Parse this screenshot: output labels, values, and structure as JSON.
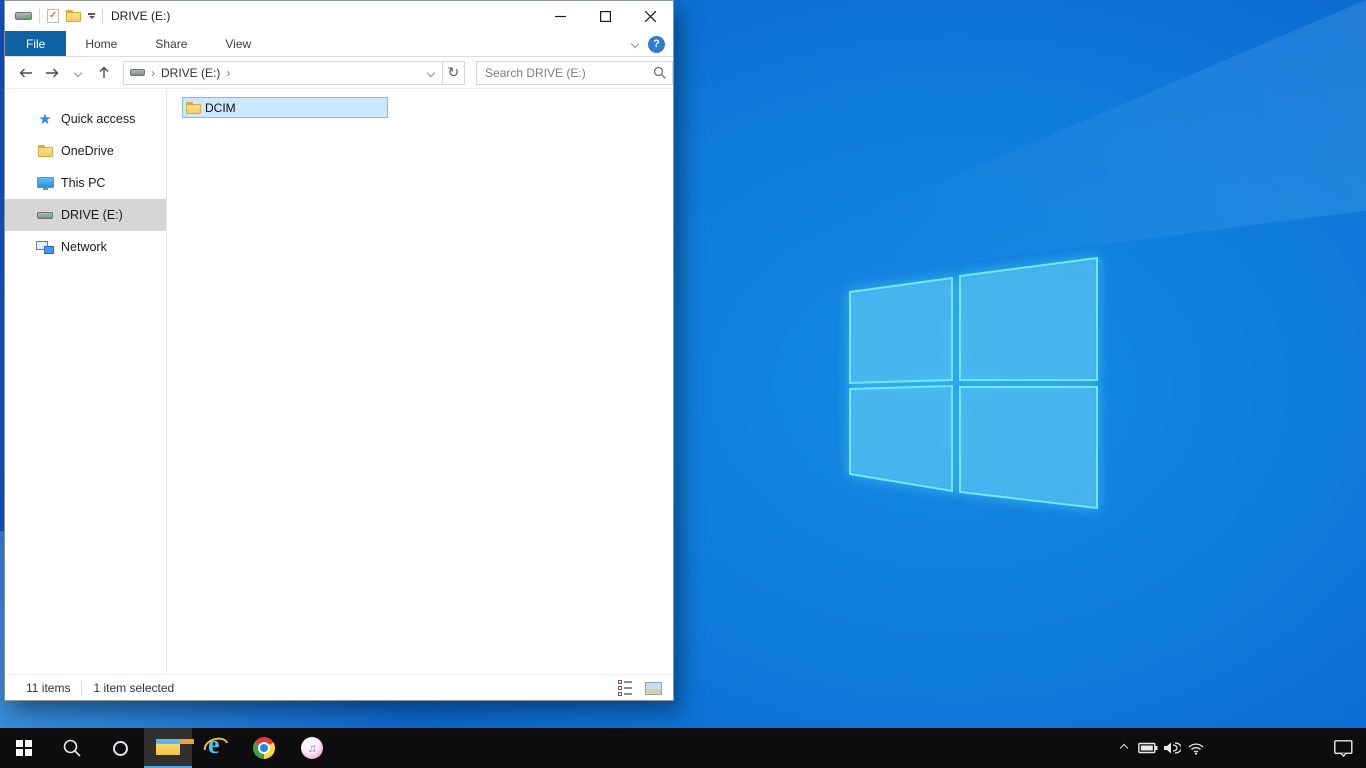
{
  "explorer": {
    "title": "DRIVE (E:)",
    "ribbon": {
      "tabs": [
        "File",
        "Home",
        "Share",
        "View"
      ]
    },
    "navigation": {
      "breadcrumb_drive": "DRIVE (E:)",
      "search_placeholder": "Search DRIVE (E:)"
    },
    "sidebar": {
      "items": [
        {
          "label": "Quick access",
          "icon": "quick-access-star-icon",
          "selected": false
        },
        {
          "label": "OneDrive",
          "icon": "folder-icon",
          "selected": false
        },
        {
          "label": "This PC",
          "icon": "computer-icon",
          "selected": false
        },
        {
          "label": "DRIVE (E:)",
          "icon": "drive-icon",
          "selected": true
        },
        {
          "label": "Network",
          "icon": "network-icon",
          "selected": false
        }
      ]
    },
    "content": {
      "items": [
        {
          "label": "DCIM",
          "icon": "folder-icon",
          "selected": true
        }
      ]
    },
    "status": {
      "item_count": "11 items",
      "selection": "1 item selected"
    }
  },
  "taskbar": {
    "buttons": [
      {
        "name": "start"
      },
      {
        "name": "search"
      },
      {
        "name": "cortana"
      },
      {
        "name": "file-explorer",
        "active": true
      },
      {
        "name": "internet-explorer"
      },
      {
        "name": "chrome"
      },
      {
        "name": "itunes"
      }
    ],
    "tray_icons": [
      "tray-expand",
      "battery",
      "volume",
      "wifi"
    ],
    "action_center": "action-center"
  },
  "colors": {
    "file_tab_blue": "#0f63a5",
    "selection_fill": "#cce8ff",
    "selection_border": "#7fbde9",
    "sidebar_selected": "#d6d6d6",
    "wallpaper_base": "#0e7ad9",
    "logo_edge_cyan": "#6fe9f6",
    "taskbar_bg": "#0d0d0f",
    "taskbar_underline": "#4da6e8",
    "status_text": "#2e2e52"
  }
}
